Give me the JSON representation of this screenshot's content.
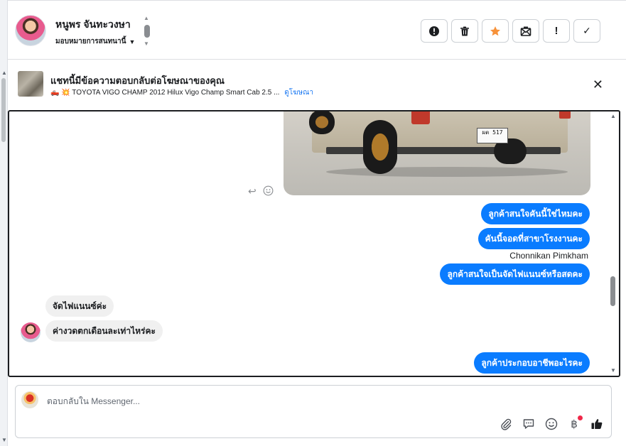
{
  "contact": {
    "name": "หนูพร จันทะวงษา",
    "assign_label": "มอบหมายการสนทนานี้"
  },
  "actions": [
    {
      "name": "mark-spam-button",
      "icon": "alert-circle-icon"
    },
    {
      "name": "delete-button",
      "icon": "trash-icon"
    },
    {
      "name": "star-button",
      "icon": "star-icon"
    },
    {
      "name": "mark-unread-button",
      "icon": "envelope-icon"
    },
    {
      "name": "follow-up-button",
      "icon": "exclamation-icon",
      "glyph": "!"
    },
    {
      "name": "mark-done-button",
      "icon": "check-icon",
      "glyph": "✓"
    }
  ],
  "ad": {
    "title": "แชทนี้มีข้อความตอบกลับต่อโฆษณาของคุณ",
    "subtitle": "🛻 💥 TOYOTA VIGO CHAMP 2012 Hilux Vigo Champ Smart Cab 2.5 ...",
    "link": "ดูโฆษณา",
    "close": "✕"
  },
  "photo": {
    "plate": "ผต 517"
  },
  "messages": [
    {
      "id": "m1",
      "direction": "out",
      "text": "ลูกค้าสนใจคันนี้ใช่ไหมคะ"
    },
    {
      "id": "m2",
      "direction": "out",
      "text": "คันนี้จอดที่สาขาโรงงานคะ"
    },
    {
      "id": "m3",
      "direction": "meta",
      "text": "Chonnikan Pimkham"
    },
    {
      "id": "m4",
      "direction": "out",
      "text": "ลูกค้าสนใจเป็นจัดไฟแนนซ์หรือสดคะ"
    },
    {
      "id": "m5",
      "direction": "in",
      "text": "จัดไฟแนนซ์ค่ะ"
    },
    {
      "id": "m6",
      "direction": "in",
      "text": "ค่างวดตกเดือนละเท่าไหร่คะ"
    },
    {
      "id": "m7",
      "direction": "out",
      "text": "ลูกค้าประกอบอาชีพอะไรคะ"
    }
  ],
  "composer": {
    "placeholder": "ตอบกลับใน Messenger..."
  },
  "colors": {
    "outgoing_bubble": "#0a7cff",
    "incoming_bubble": "#f0f0f0",
    "link": "#1877f2",
    "star": "#f7923a",
    "notification_dot": "#f02849"
  }
}
